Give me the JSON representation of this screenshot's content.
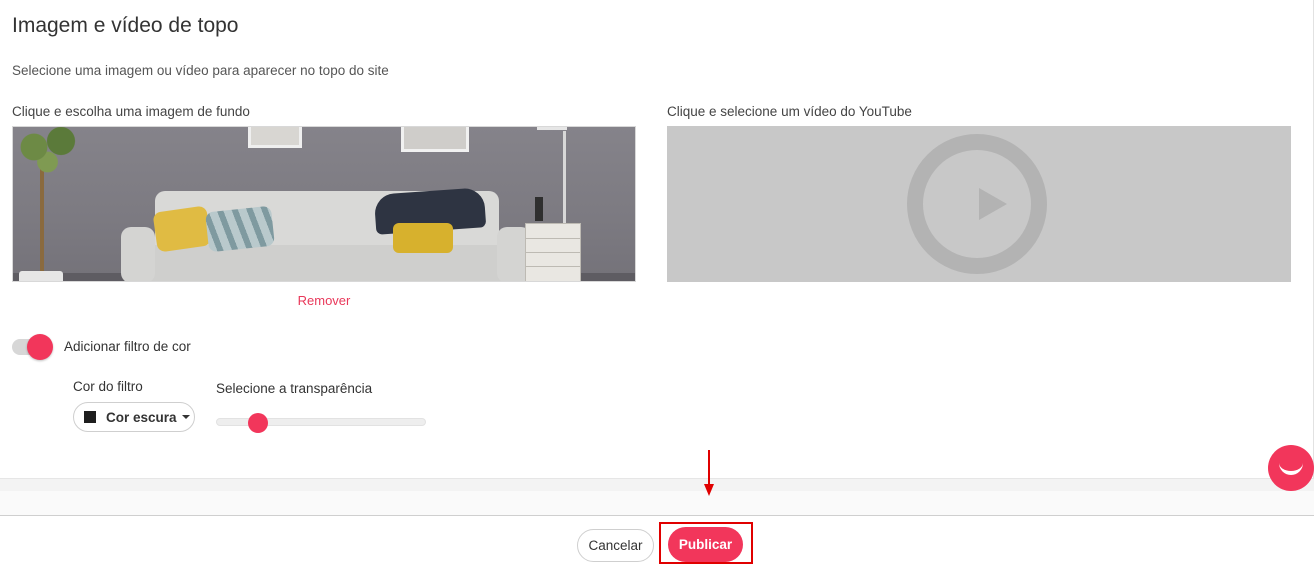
{
  "section": {
    "title": "Imagem e vídeo de topo",
    "subtitle": "Selecione uma imagem ou vídeo para aparecer no topo do site"
  },
  "image_picker": {
    "label": "Clique e escolha uma imagem de fundo",
    "remove_label": "Remover"
  },
  "video_picker": {
    "label": "Clique e selecione um vídeo do YouTube",
    "icon": "play-icon"
  },
  "color_filter": {
    "toggle_label": "Adicionar filtro de cor",
    "enabled": true,
    "color_label": "Cor do filtro",
    "color_value": "Cor escura",
    "transparency_label": "Selecione a transparência",
    "transparency_value": 0.2
  },
  "footer": {
    "cancel_label": "Cancelar",
    "publish_label": "Publicar"
  },
  "colors": {
    "accent": "#f2365b",
    "annotation": "#e00000"
  }
}
